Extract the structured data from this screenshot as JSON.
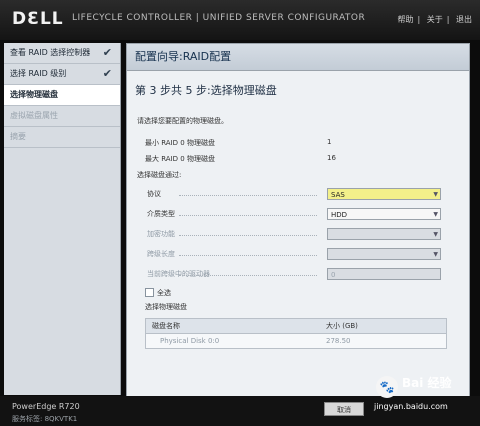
{
  "header": {
    "logo": "DƐLL",
    "product": "LIFECYCLE CONTROLLER  |  UNIFIED SERVER CONFIGURATOR",
    "links": [
      "帮助",
      "关于",
      "退出"
    ]
  },
  "sidebar": {
    "items": [
      {
        "label": "查看 RAID 选择控制器",
        "state": "done"
      },
      {
        "label": "选择 RAID 级别",
        "state": "done"
      },
      {
        "label": "选择物理磁盘",
        "state": "active"
      },
      {
        "label": "虚拟磁盘属性",
        "state": "disabled"
      },
      {
        "label": "摘要",
        "state": "disabled"
      }
    ],
    "check_glyph": "✔"
  },
  "main": {
    "wizard_title": "配置向导:RAID配置",
    "step_title": "第 3 步共 5 步:选择物理磁盘",
    "instruction": "请选择您要配置的物理磁盘。",
    "min_label": "最小 RAID 0 物理磁盘",
    "min_value": "1",
    "max_label": "最大 RAID 0 物理磁盘",
    "max_value": "16",
    "filter_heading": "选择磁盘通过:",
    "protocol_label": "协议",
    "protocol_value": "SAS",
    "media_label": "介质类型",
    "media_value": "HDD",
    "encryption_label": "加密功能",
    "span_length_label": "跨级长度",
    "span_count_label": "当前跨级中的驱动器",
    "span_count_value": "0",
    "select_all": "全选",
    "select_heading": "选择物理磁盘",
    "table_headers": [
      "磁盘名称",
      "大小 (GB)"
    ],
    "table_rows": [
      [
        "Physical Disk 0:0",
        "278.50"
      ]
    ]
  },
  "footer": {
    "model": "PowerEdge R720",
    "service_tag": "服务标签: 8QKVTK1",
    "cancel": "取消"
  },
  "watermark": {
    "brand": "Bai 经验",
    "url": "jingyan.baidu.com"
  },
  "colors": {
    "highlight": "#f3f08a",
    "sidebar_bg": "#d7dce2",
    "panel_bg": "#eef1f4"
  }
}
